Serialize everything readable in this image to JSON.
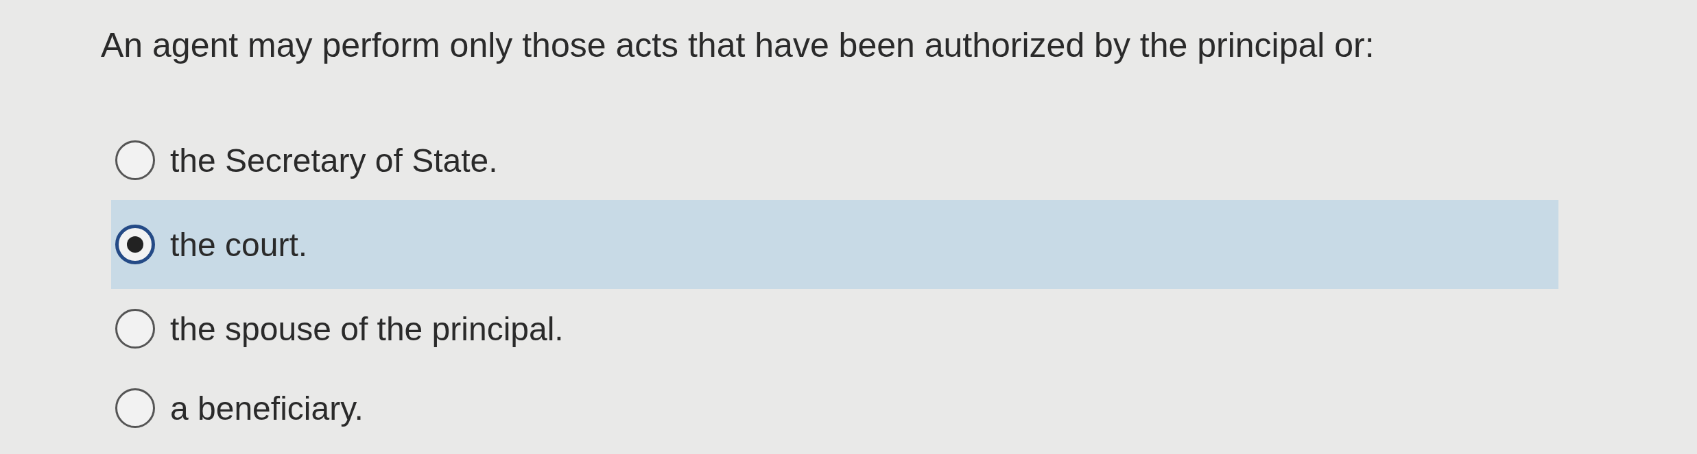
{
  "question": "An agent may perform only those acts that have been authorized by the principal or:",
  "options": [
    {
      "label": "the Secretary of State.",
      "selected": false
    },
    {
      "label": "the court.",
      "selected": true
    },
    {
      "label": "the spouse of the principal.",
      "selected": false
    },
    {
      "label": "a beneficiary.",
      "selected": false
    }
  ]
}
